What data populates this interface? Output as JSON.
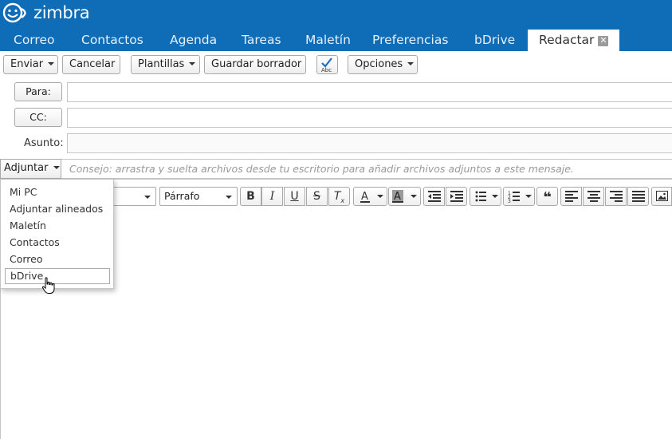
{
  "app": {
    "brand": "zimbra",
    "brand_color": "#0f6cb6"
  },
  "nav": {
    "tabs": [
      {
        "label": "Correo"
      },
      {
        "label": "Contactos"
      },
      {
        "label": "Agenda"
      },
      {
        "label": "Tareas"
      },
      {
        "label": "Maletín"
      },
      {
        "label": "Preferencias"
      },
      {
        "label": "bDrive"
      },
      {
        "label": "Redactar",
        "active": true
      }
    ]
  },
  "toolbar": {
    "send": "Enviar",
    "cancel": "Cancelar",
    "templates": "Plantillas",
    "save_draft": "Guardar borrador",
    "spellcheck_icon": "spellcheck-icon",
    "spellcheck_label": "Abc",
    "options": "Opciones"
  },
  "fields": {
    "to_label": "Para:",
    "to_value": "",
    "cc_label": "CC:",
    "cc_value": "",
    "subject_label": "Asunto:",
    "subject_value": ""
  },
  "attach": {
    "button": "Adjuntar",
    "hint": "Consejo: arrastra y suelta archivos desde tu escritorio para añadir archivos adjuntos a este mensaje.",
    "menu_items": [
      "Mi PC",
      "Adjuntar alineados",
      "Maletín",
      "Contactos",
      "Correo",
      "bDrive"
    ],
    "hovered_item": "bDrive"
  },
  "editor": {
    "paragraph_format": "Párrafo",
    "format_buttons": [
      "bold-icon",
      "italic-icon",
      "underline-icon",
      "strikethrough-icon",
      "clear-format-icon",
      "font-color-icon",
      "highlight-color-icon",
      "outdent-icon",
      "indent-icon",
      "bullet-list-icon",
      "numbered-list-icon",
      "blockquote-icon",
      "align-left-icon",
      "align-center-icon",
      "align-right-icon",
      "align-justify-icon",
      "insert-image-icon"
    ],
    "body": ""
  }
}
